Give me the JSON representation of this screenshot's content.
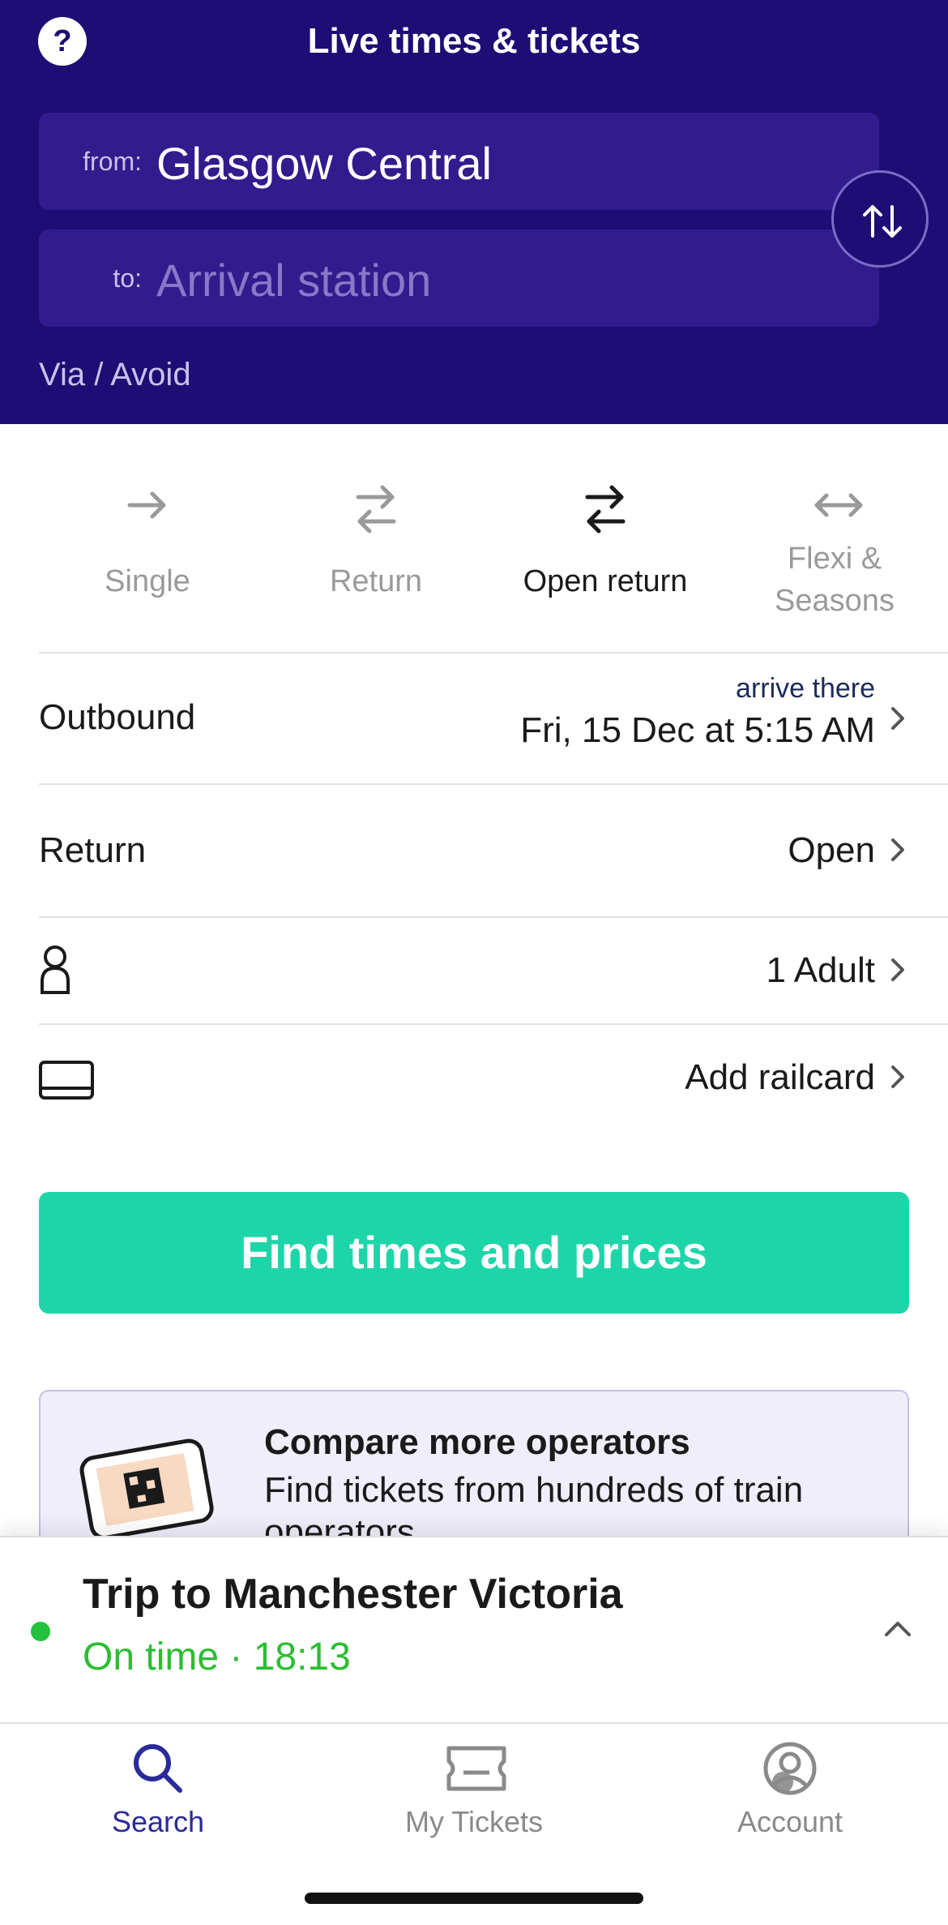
{
  "header": {
    "title": "Live times & tickets",
    "help_label": "?",
    "from_label": "from:",
    "from_value": "Glasgow Central",
    "to_label": "to:",
    "to_placeholder": "Arrival station",
    "via_label": "Via / Avoid"
  },
  "trip_types": [
    {
      "label": "Single",
      "icon": "arrow-right-icon",
      "active": false
    },
    {
      "label": "Return",
      "icon": "return-arrows-icon",
      "active": false
    },
    {
      "label": "Open return",
      "icon": "open-return-arrows-icon",
      "active": true
    },
    {
      "label": "Flexi & Seasons",
      "icon": "double-arrow-icon",
      "active": false
    }
  ],
  "outbound": {
    "label": "Outbound",
    "sub": "arrive there",
    "value": "Fri, 15 Dec at 5:15 AM"
  },
  "return_row": {
    "label": "Return",
    "value": "Open"
  },
  "passengers": {
    "value": "1 Adult",
    "icon": "person-icon"
  },
  "railcard": {
    "value": "Add railcard",
    "icon": "railcard-icon"
  },
  "cta": {
    "label": "Find times and prices"
  },
  "promo": {
    "title": "Compare more operators",
    "text": "Find tickets from hundreds of train operators"
  },
  "trip": {
    "title": "Trip to Manchester Victoria",
    "status": "On time · 18:13"
  },
  "nav": [
    {
      "label": "Search",
      "icon": "search-icon",
      "active": true
    },
    {
      "label": "My Tickets",
      "icon": "ticket-icon",
      "active": false
    },
    {
      "label": "Account",
      "icon": "account-icon",
      "active": false
    }
  ],
  "colors": {
    "header_bg": "#1d0d74",
    "cta": "#1ed5a9",
    "on_time": "#2bbd33",
    "nav_active": "#2a2a9a"
  }
}
